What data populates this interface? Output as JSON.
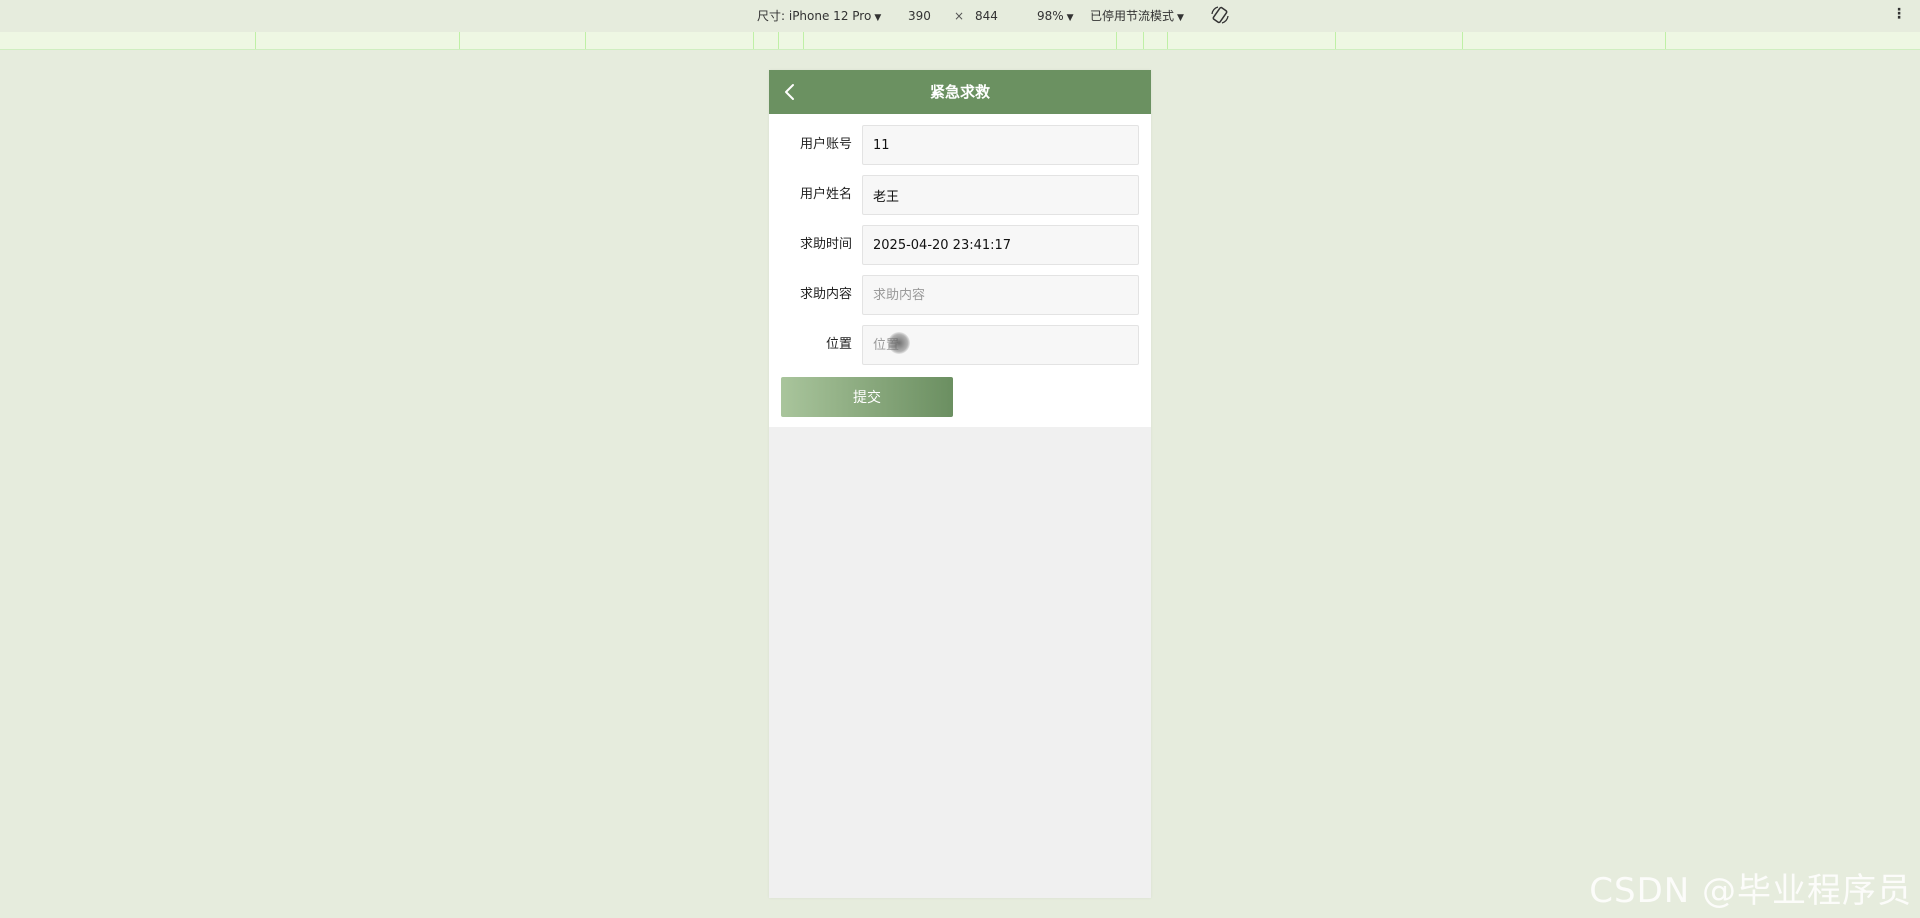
{
  "devtools": {
    "device_label": "尺寸: iPhone 12 Pro",
    "width_value": "390",
    "times_symbol": "×",
    "height_value": "844",
    "zoom_label": "98%",
    "throttle_label": "已停用节流模式",
    "menu_symbol": "⋮"
  },
  "header": {
    "title": "紧急求救"
  },
  "form": {
    "fields": [
      {
        "label": "用户账号",
        "value": "11",
        "placeholder": ""
      },
      {
        "label": "用户姓名",
        "value": "老王",
        "placeholder": ""
      },
      {
        "label": "求助时间",
        "value": "2025-04-20 23:41:17",
        "placeholder": ""
      },
      {
        "label": "求助内容",
        "value": "",
        "placeholder": "求助内容"
      },
      {
        "label": "位置",
        "value": "",
        "placeholder": "位置"
      }
    ],
    "submit_label": "提交"
  },
  "watermark": "CSDN @毕业程序员",
  "colors": {
    "header_bg": "#6b9161",
    "page_bg": "#e6ecdd",
    "button_gradient_start": "#a9c59c",
    "button_gradient_end": "#6b8f61"
  }
}
